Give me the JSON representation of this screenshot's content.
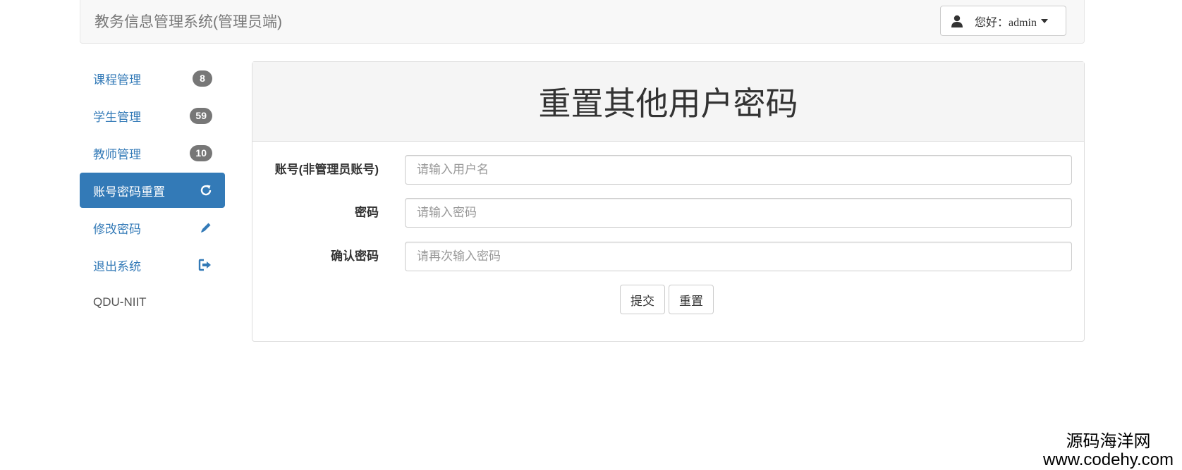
{
  "navbar": {
    "brand": "教务信息管理系统(管理员端)",
    "user_label": "您好：admin",
    "user_icon": "user-icon"
  },
  "sidebar": {
    "items": [
      {
        "label": "课程管理",
        "badge": "8",
        "active": false
      },
      {
        "label": "学生管理",
        "badge": "59",
        "active": false
      },
      {
        "label": "教师管理",
        "badge": "10",
        "active": false
      },
      {
        "label": "账号密码重置",
        "icon": "refresh-icon",
        "active": true
      },
      {
        "label": "修改密码",
        "icon": "pencil-icon",
        "active": false
      },
      {
        "label": "退出系统",
        "icon": "logout-icon",
        "active": false
      }
    ],
    "footer": "QDU-NIIT"
  },
  "panel": {
    "title": "重置其他用户密码",
    "fields": [
      {
        "label": "账号(非管理员账号)",
        "placeholder": "请输入用户名",
        "value": ""
      },
      {
        "label": "密码",
        "placeholder": "请输入密码",
        "value": ""
      },
      {
        "label": "确认密码",
        "placeholder": "请再次输入密码",
        "value": ""
      }
    ],
    "submit_label": "提交",
    "reset_label": "重置"
  },
  "watermark": {
    "line1": "源码海洋网",
    "line2": "www.codehy.com"
  },
  "colors": {
    "accent": "#337ab7",
    "badge": "#777777",
    "navbar_bg": "#f8f8f8"
  }
}
